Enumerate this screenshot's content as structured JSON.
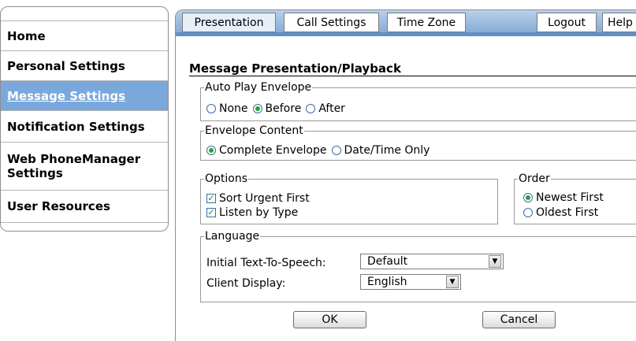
{
  "sidebar": {
    "items": [
      {
        "label": "Home"
      },
      {
        "label": "Personal Settings"
      },
      {
        "label": "Message Settings"
      },
      {
        "label": "Notification Settings"
      },
      {
        "label": "Web PhoneManager Settings"
      },
      {
        "label": "User Resources"
      }
    ]
  },
  "tabs": {
    "presentation": "Presentation",
    "call_settings": "Call Settings",
    "time_zone": "Time Zone",
    "logout": "Logout",
    "help": "Help"
  },
  "section_title": "Message Presentation/Playback",
  "auto_play": {
    "legend": "Auto Play Envelope",
    "options": [
      "None",
      "Before",
      "After"
    ],
    "selected": "Before"
  },
  "envelope_content": {
    "legend": "Envelope Content",
    "options": [
      "Complete Envelope",
      "Date/Time Only"
    ],
    "selected": "Complete Envelope"
  },
  "options_group": {
    "legend": "Options",
    "items": [
      {
        "label": "Sort Urgent First",
        "checked": true
      },
      {
        "label": "Listen by Type",
        "checked": true
      }
    ]
  },
  "order": {
    "legend": "Order",
    "options": [
      "Newest First",
      "Oldest First"
    ],
    "selected": "Newest First"
  },
  "language": {
    "legend": "Language",
    "tts_label": "Initial Text-To-Speech:",
    "tts_value": "Default",
    "display_label": "Client Display:",
    "display_value": "English"
  },
  "buttons": {
    "ok": "OK",
    "cancel": "Cancel"
  },
  "colors": {
    "active_sidebar": "#7aa8dc",
    "tab_bar": "#7ea6d3",
    "radio_on": "#27a33b"
  }
}
